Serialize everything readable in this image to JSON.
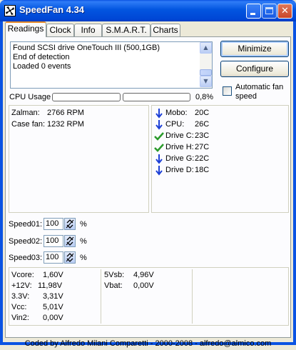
{
  "window": {
    "title": "SpeedFan 4.34"
  },
  "tabs": [
    {
      "label": "Readings",
      "active": true
    },
    {
      "label": "Clock",
      "active": false
    },
    {
      "label": "Info",
      "active": false
    },
    {
      "label": "S.M.A.R.T.",
      "active": false
    },
    {
      "label": "Charts",
      "active": false
    }
  ],
  "log": [
    "Found SCSI drive OneTouch III (500,1GB)",
    "End of detection",
    "Loaded 0 events"
  ],
  "buttons": {
    "minimize": "Minimize",
    "configure": "Configure"
  },
  "auto_fan": {
    "label_line1": "Automatic fan",
    "label_line2": "speed",
    "checked": false
  },
  "cpu_usage": {
    "label": "CPU Usage",
    "value": "0,8%",
    "bar1": 0,
    "bar2": 0
  },
  "fans": [
    {
      "name": "Zalman:",
      "value": "2766 RPM"
    },
    {
      "name": "Case fan:",
      "value": "1232 RPM"
    }
  ],
  "temps": [
    {
      "icon": "arrow-down-icon",
      "name": "Mobo:",
      "value": "20C"
    },
    {
      "icon": "arrow-down-icon",
      "name": "CPU:",
      "value": "26C"
    },
    {
      "icon": "check-icon",
      "name": "Drive C:",
      "value": "23C"
    },
    {
      "icon": "check-icon",
      "name": "Drive H:",
      "value": "27C"
    },
    {
      "icon": "arrow-down-icon",
      "name": "Drive G:",
      "value": "22C"
    },
    {
      "icon": "arrow-down-icon",
      "name": "Drive D:",
      "value": "18C"
    }
  ],
  "speeds": [
    {
      "label": "Speed01:",
      "value": "100",
      "unit": "%"
    },
    {
      "label": "Speed02:",
      "value": "100",
      "unit": "%"
    },
    {
      "label": "Speed03:",
      "value": "100",
      "unit": "%"
    }
  ],
  "voltages_left": [
    {
      "name": "Vcore:",
      "value": "1,60V"
    },
    {
      "name": "+12V:",
      "value": "11,98V"
    },
    {
      "name": "3.3V:",
      "value": "3,31V"
    },
    {
      "name": "Vcc:",
      "value": "5,01V"
    },
    {
      "name": "Vin2:",
      "value": "0,00V"
    }
  ],
  "voltages_right": [
    {
      "name": "5Vsb:",
      "value": "4,96V"
    },
    {
      "name": "Vbat:",
      "value": "0,00V"
    }
  ],
  "footer": "Coded by Alfredo Milani Comparetti - 2000-2008 - alfredo@almico.com",
  "colors": {
    "arrow": "#1c3fd6",
    "check": "#2a9a2a",
    "titlebar": "#0a53e3"
  }
}
